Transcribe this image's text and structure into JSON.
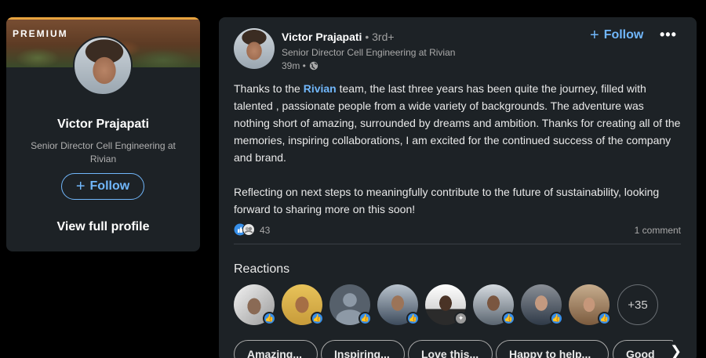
{
  "profile_card": {
    "badge": "PREMIUM",
    "name": "Victor Prajapati",
    "headline": "Senior Director Cell Engineering at Rivian",
    "follow_label": "Follow",
    "view_profile_label": "View full profile"
  },
  "post": {
    "author_name": "Victor Prajapati",
    "degree": "• 3rd+",
    "headline": "Senior Director Cell Engineering at Rivian",
    "time": "39m •",
    "follow_label": "Follow",
    "body_intro": "Thanks to the ",
    "mention": "Rivian",
    "body_rest": " team, the last three years has been quite the journey, filled with talented , passionate people from a wide variety of backgrounds. The adventure was nothing short of amazing, surrounded by dreams and ambition. Thanks for creating all of the memories, inspiring collaborations, I am excited for the continued success of the company and brand.",
    "body_para2": "Reflecting on next steps to meaningfully contribute to the future of sustainability, looking forward to sharing more on this soon!",
    "reaction_count": "43",
    "comment_count": "1 comment",
    "reactions_title": "Reactions",
    "more_reactors": "+35",
    "suggestions": [
      "Amazing...",
      "Inspiring...",
      "Love this...",
      "Happy to help...",
      "Good"
    ]
  },
  "icons": {
    "like_icon": "thumbs-up",
    "globe_icon": "globe",
    "more_icon": "ellipsis",
    "next_icon": "chevron-right"
  },
  "colors": {
    "accent": "#71b7fb",
    "card_bg": "#1d2226",
    "page_bg": "#000000",
    "like_badge": "#378fe9",
    "premium_line": "#e7a33e"
  }
}
